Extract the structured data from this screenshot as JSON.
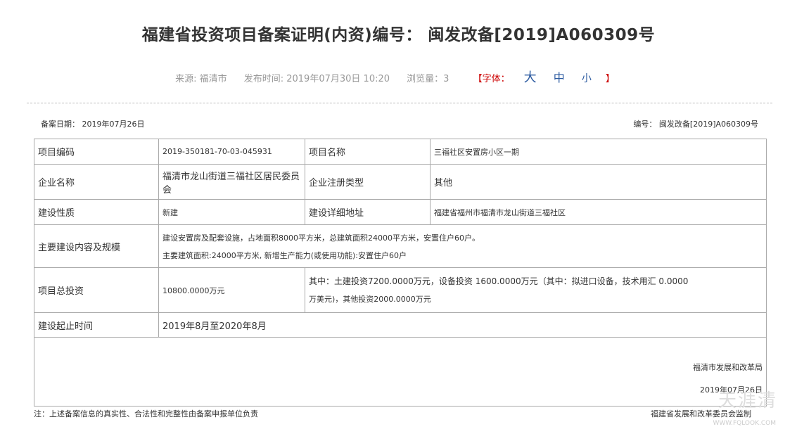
{
  "header": {
    "title": "福建省投资项目备案证明(内资)编号： 闽发改备[2019]A060309号",
    "source": "来源: 福清市",
    "publish_time": "发布时间: 2019年07月30日 10:20",
    "views": "浏览量：3",
    "font_label_open": "【字体：",
    "font_large": "大",
    "font_medium": "中",
    "font_small": "小",
    "font_label_close": "】"
  },
  "record": {
    "date": "备案日期： 2019年07月26日",
    "number": "编号： 闽发改备[2019]A060309号"
  },
  "table": {
    "project_code_label": "项目编码",
    "project_code": "2019-350181-70-03-045931",
    "project_name_label": "项目名称",
    "project_name": "三福社区安置房小区一期",
    "company_label": "企业名称",
    "company": "福清市龙山街道三福社区居民委员会",
    "reg_type_label": "企业注册类型",
    "reg_type": "其他",
    "nature_label": "建设性质",
    "nature": "新建",
    "address_label": "建设详细地址",
    "address": "福建省福州市福清市龙山街道三福社区",
    "scope_label": "主要建设内容及规模",
    "scope_line1": "建设安置房及配套设施，占地面积8000平方米，总建筑面积24000平方米，安置住户60户。",
    "scope_line2": "主要建筑面积:24000平方米, 新增生产能力(或使用功能):安置住户60户",
    "investment_label": "项目总投资",
    "investment": "10800.0000万元",
    "investment_detail_line1": "其中：土建投资7200.0000万元，设备投资 1600.0000万元（其中：拟进口设备，技术用汇 0.0000",
    "investment_detail_line2": "万美元)，其他投资2000.0000万元",
    "period_label": "建设起止时间",
    "period": "2019年8月至2020年8月",
    "org": "福清市发展和改革局",
    "org_date": "2019年07月26日"
  },
  "footer": {
    "note": "注：上述备案信息的真实性、合法性和完整性由备案申报单位负责",
    "maker": "福建省发展和改革委员会监制"
  },
  "watermark": {
    "text": "天涯清",
    "url": "WWW.FQLOOK.COM"
  }
}
